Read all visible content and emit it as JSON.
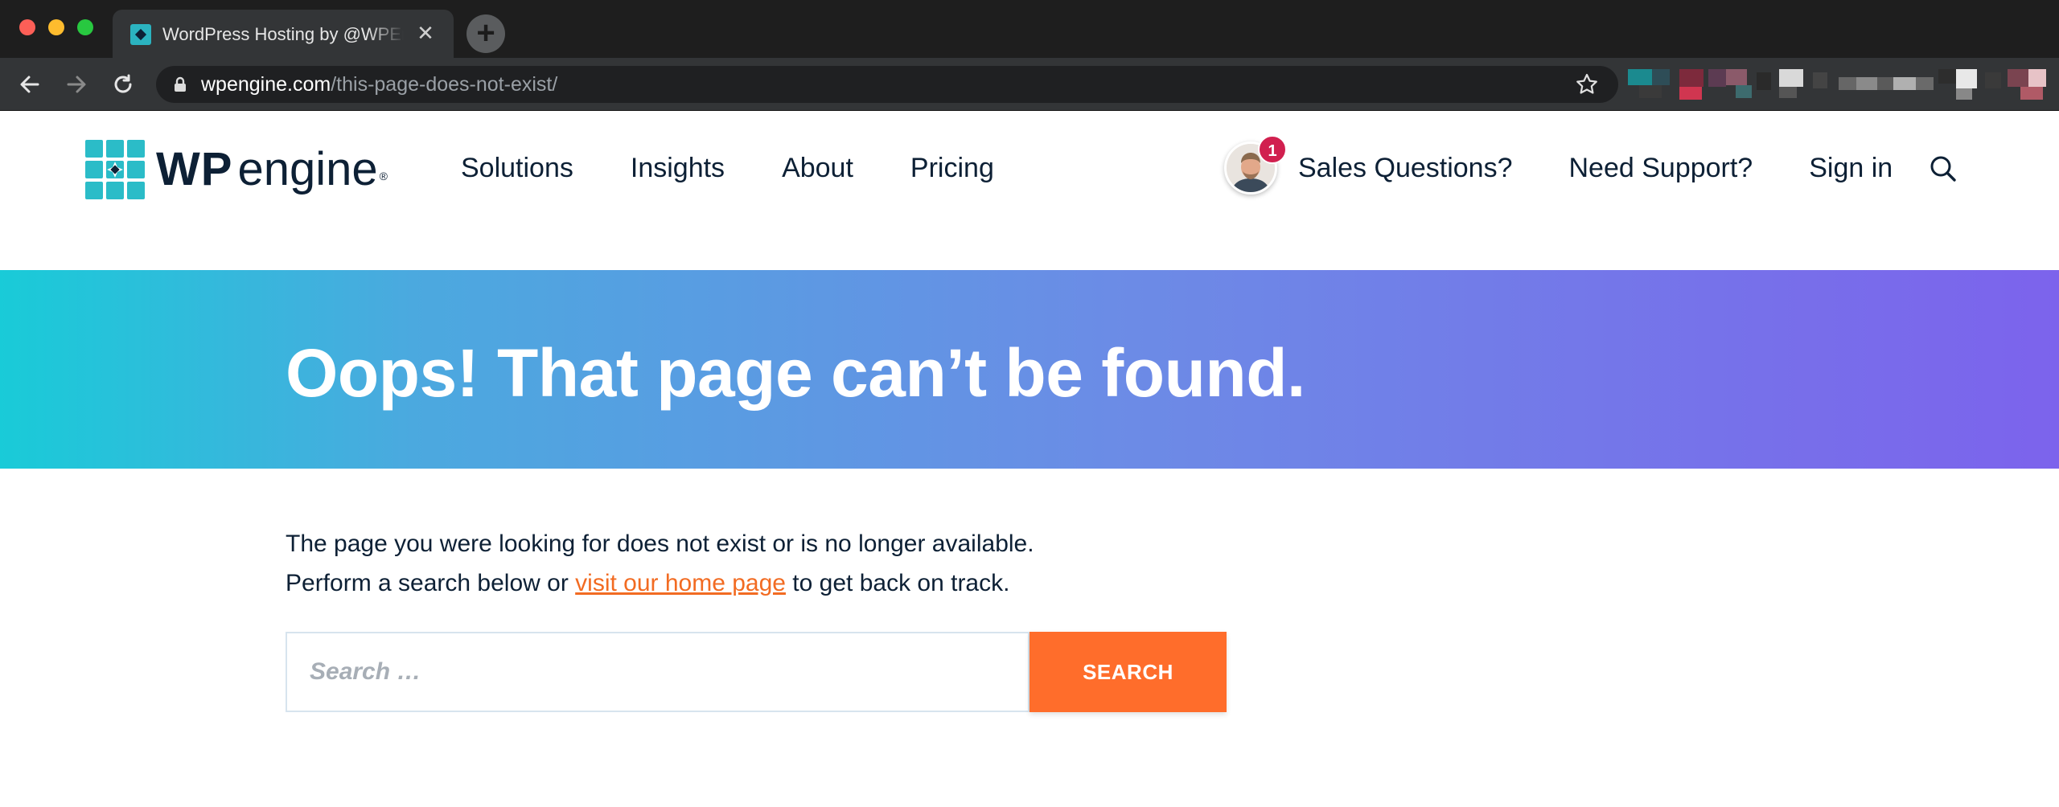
{
  "browser": {
    "tab_title": "WordPress Hosting by @WPEngine",
    "tab_close": "✕",
    "new_tab": "+",
    "url_host": "wpengine.com",
    "url_path": "/this-page-does-not-exist/"
  },
  "header": {
    "logo_wp": "WP",
    "logo_engine": "engine",
    "logo_reg": "®",
    "nav_left": [
      "Solutions",
      "Insights",
      "About",
      "Pricing"
    ],
    "notification_count": "1",
    "nav_right": [
      "Sales Questions?",
      "Need Support?",
      "Sign in"
    ],
    "colors": {
      "brand_teal": "#2bb3c0",
      "navy": "#0d2035",
      "badge": "#d1204f"
    }
  },
  "hero": {
    "title": "Oops! That page can’t be found.",
    "gradient": [
      "#19cbd8",
      "#7c63ec"
    ]
  },
  "content": {
    "line1": "The page you were looking for does not exist or is no longer available.",
    "line2_before": "Perform a search below or ",
    "line2_link": "visit our home page",
    "line2_after": " to get back on track.",
    "link_color": "#f26b22"
  },
  "search": {
    "placeholder": "Search …",
    "button_label": "SEARCH",
    "button_color": "#ff6d2b"
  },
  "icons": [
    "back-arrow-icon",
    "forward-arrow-icon",
    "reload-icon",
    "lock-icon",
    "bookmark-star-icon",
    "search-icon",
    "new-tab-icon",
    "close-icon"
  ]
}
